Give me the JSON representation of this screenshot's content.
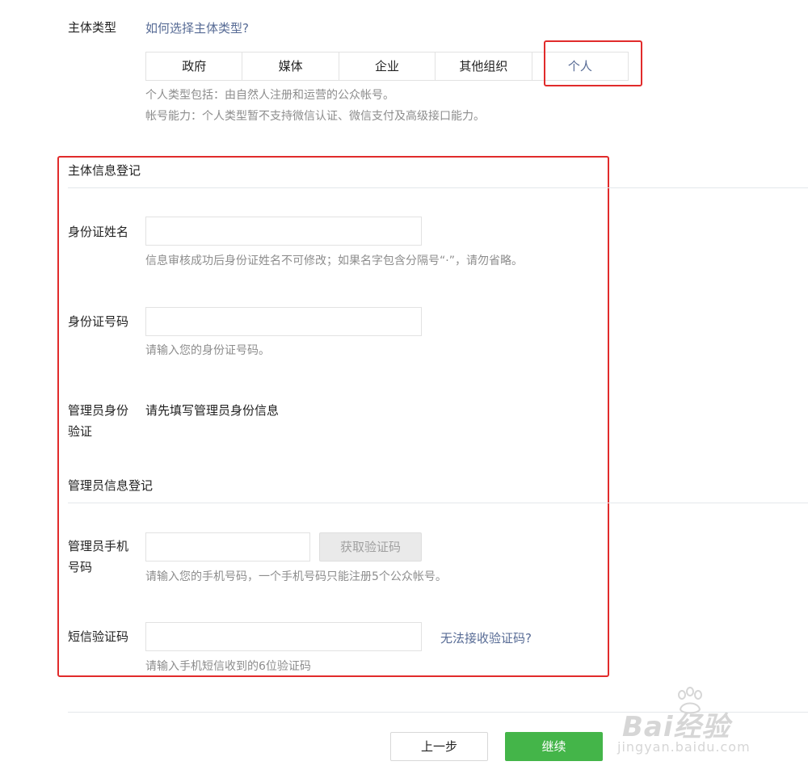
{
  "subject_type": {
    "label": "主体类型",
    "help_link": "如何选择主体类型?",
    "options": [
      "政府",
      "媒体",
      "企业",
      "其他组织",
      "个人"
    ],
    "selected": "个人",
    "desc_1": "个人类型包括：由自然人注册和运营的公众帐号。",
    "desc_2": "帐号能力：个人类型暂不支持微信认证、微信支付及高级接口能力。"
  },
  "subject_info": {
    "title": "主体信息登记",
    "id_name": {
      "label": "身份证姓名",
      "value": "",
      "hint": "信息审核成功后身份证姓名不可修改；如果名字包含分隔号“·”，请勿省略。"
    },
    "id_number": {
      "label": "身份证号码",
      "value": "",
      "hint": "请输入您的身份证号码。"
    },
    "admin_verify": {
      "label_line1": "管理员身份",
      "label_line2": "验证",
      "text": "请先填写管理员身份信息"
    }
  },
  "admin_info": {
    "title": "管理员信息登记",
    "phone": {
      "label_line1": "管理员手机",
      "label_line2": "号码",
      "value": "",
      "get_code_button": "获取验证码",
      "hint": "请输入您的手机号码，一个手机号码只能注册5个公众帐号。"
    },
    "sms": {
      "label": "短信验证码",
      "value": "",
      "cannot_receive_link": "无法接收验证码?",
      "hint": "请输入手机短信收到的6位验证码"
    }
  },
  "footer": {
    "prev_button": "上一步",
    "continue_button": "继续"
  },
  "watermark": {
    "brand": "Bai经验",
    "url": "jingyan.baidu.com"
  },
  "colors": {
    "link": "#576b95",
    "primary_green": "#44b549",
    "highlight_red": "#e12b2b",
    "hint_gray": "#8d8d8d"
  }
}
